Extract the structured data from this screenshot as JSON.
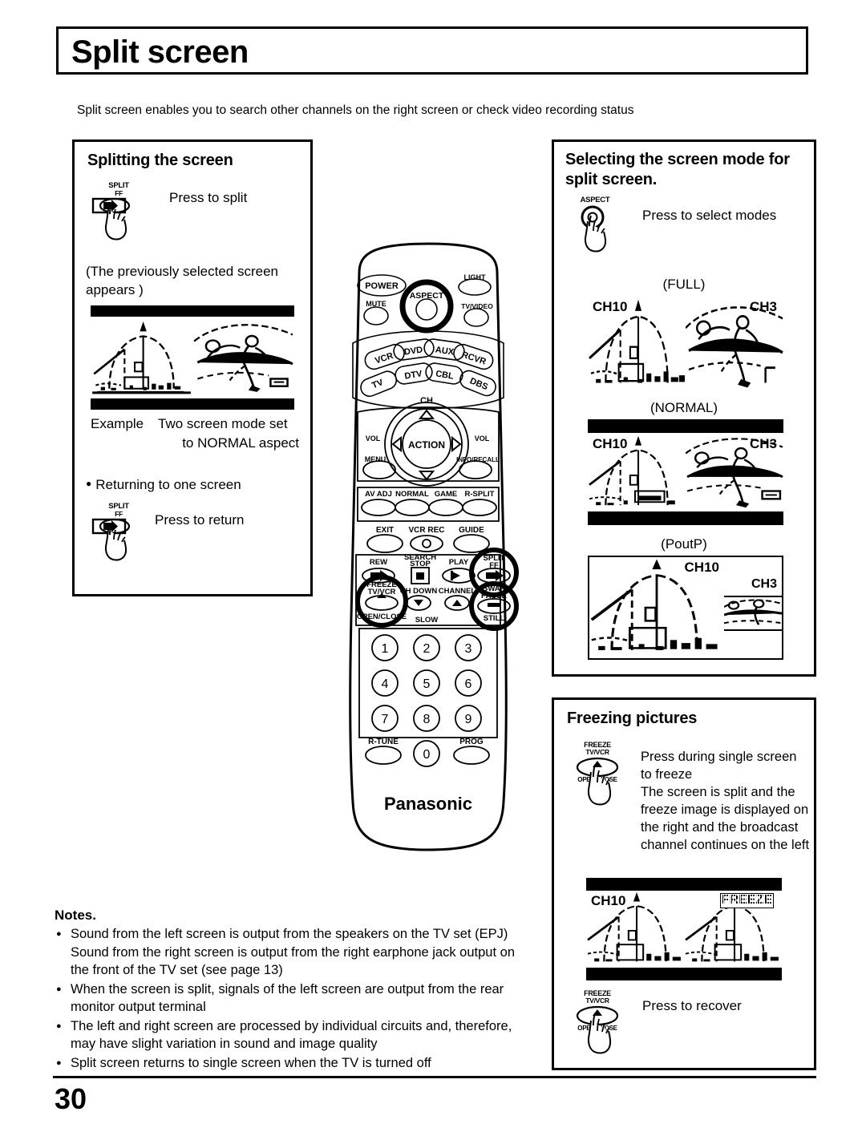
{
  "page": {
    "title": "Split screen",
    "intro": "Split screen enables you to search other channels on the right screen or check video recording status",
    "number": "30"
  },
  "splitting_panel": {
    "title": "Splitting the screen",
    "press_split": "Press to split",
    "note": "(The previously selected screen appears )",
    "example_label": "Example",
    "example_line1": "Two screen mode set",
    "example_line2": "to NORMAL aspect",
    "returning_heading": "Returning to one screen",
    "press_return": "Press to return",
    "split_button": {
      "line1": "SPLIT",
      "line2": "FF"
    },
    "screen": {
      "left_channel": "",
      "right_channel": "",
      "letterbox": true
    }
  },
  "mode_panel": {
    "title": "Selecting the screen mode for split screen.",
    "press_select": "Press to select modes",
    "aspect_button": {
      "line1": "ASPECT"
    },
    "modes": [
      {
        "label": "(FULL)",
        "left_channel": "CH10",
        "right_channel": "CH3",
        "letterbox": false,
        "layout": "split"
      },
      {
        "label": "(NORMAL)",
        "left_channel": "CH10",
        "right_channel": "CH3",
        "letterbox": true,
        "layout": "split"
      },
      {
        "label": "(PoutP)",
        "left_channel": "CH10",
        "right_channel": "CH3",
        "letterbox": false,
        "layout": "pip"
      }
    ]
  },
  "freeze_panel": {
    "title": "Freezing pictures",
    "text_line1": "Press during single screen to freeze",
    "text_line2": "The screen is split and the freeze image is displayed on the right and the broadcast channel continues on the left",
    "press_recover": "Press to recover",
    "freeze_button": {
      "line1": "FREEZE",
      "line2": "TV/VCR",
      "line3": "OPEN/CLOSE"
    },
    "screen": {
      "left_channel": "CH10",
      "right_badge": "FREEZE",
      "letterbox": true
    }
  },
  "notes": {
    "heading": "Notes.",
    "items": [
      "Sound from the left screen is output from the speakers on the TV set (EPJ) Sound from the right screen is output from the right earphone jack output on the front of the TV set (see page 13)",
      "When the screen is split, signals of the left screen are output from the rear monitor output terminal",
      "The left and right screen are processed by individual circuits and, therefore, may have slight variation in sound and image quality",
      "Split screen returns to single screen when the TV is turned off"
    ]
  },
  "remote": {
    "brand": "Panasonic",
    "power": "POWER",
    "light": "LIGHT",
    "mute": "MUTE",
    "aspect": "ASPECT",
    "tv_video": "TV/VIDEO",
    "device_row1": [
      "VCR",
      "DVD",
      "AUX",
      "RCVR"
    ],
    "device_row2": [
      "TV",
      "DTV",
      "CBL",
      "DBS"
    ],
    "ch_label": "CH",
    "vol_minus": "VOL",
    "vol_plus": "VOL",
    "action": "ACTION",
    "menu": "MENU",
    "info_recall": "INFO/RECALL",
    "function_row": [
      "AV ADJ",
      "NORMAL",
      "GAME",
      "R-SPLIT"
    ],
    "exit": "EXIT",
    "vcr_rec": "VCR REC",
    "guide": "GUIDE",
    "rew": "REW",
    "search_stop": "SEARCH STOP",
    "play": "PLAY",
    "split_ff": {
      "line1": "SPLIT",
      "line2": "FF"
    },
    "freeze": {
      "line1": "FREEZE",
      "line2": "TV/VCR",
      "line3": "OPEN/CLOSE"
    },
    "ch_down": "CH DOWN",
    "ch_up": "CHANNEL",
    "swap": {
      "line1": "SWAP",
      "line2": "PAUSE",
      "line3": "STILL"
    },
    "slow": "SLOW",
    "keys": [
      "1",
      "2",
      "3",
      "4",
      "5",
      "6",
      "7",
      "8",
      "9",
      "0"
    ],
    "r_tune": "R-TUNE",
    "prog": "PROG"
  }
}
